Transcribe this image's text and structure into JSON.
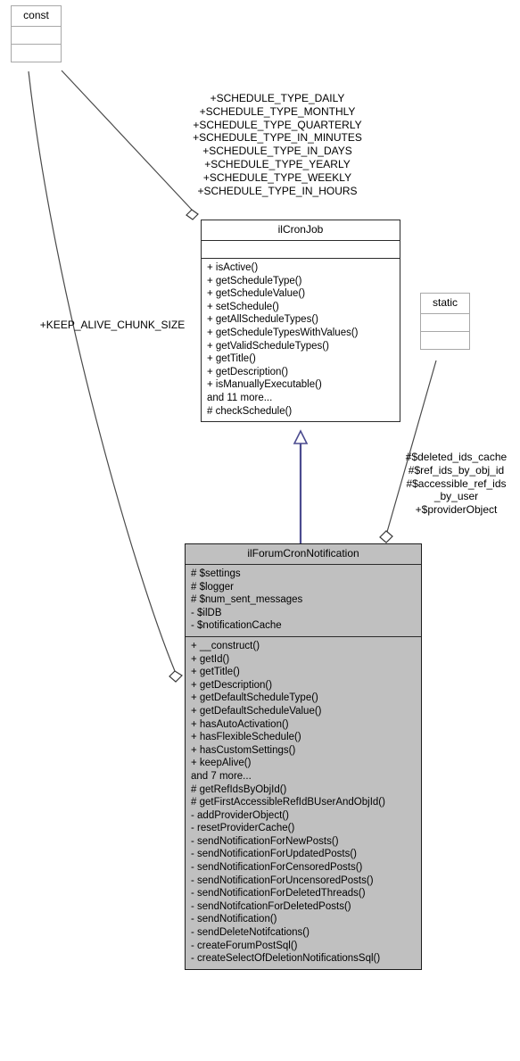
{
  "diagram": {
    "type": "uml-class-diagram",
    "main_class": "ilForumCronNotification"
  },
  "boxes": {
    "const": {
      "title": "const",
      "attributes": [],
      "methods": []
    },
    "cronjob": {
      "title": "ilCronJob",
      "attributes": [],
      "methods": [
        "+ isActive()",
        "+ getScheduleType()",
        "+ getScheduleValue()",
        "+ setSchedule()",
        "+ getAllScheduleTypes()",
        "+ getScheduleTypesWithValues()",
        "+ getValidScheduleTypes()",
        "+ getTitle()",
        "+ getDescription()",
        "+ isManuallyExecutable()",
        "and 11 more...",
        "# checkSchedule()"
      ]
    },
    "static": {
      "title": "static",
      "attributes": [],
      "methods": []
    },
    "main": {
      "title": "ilForumCronNotification",
      "attributes": [
        "# $settings",
        "# $logger",
        "# $num_sent_messages",
        "- $ilDB",
        "- $notificationCache"
      ],
      "methods": [
        "+ __construct()",
        "+ getId()",
        "+ getTitle()",
        "+ getDescription()",
        "+ getDefaultScheduleType()",
        "+ getDefaultScheduleValue()",
        "+ hasAutoActivation()",
        "+ hasFlexibleSchedule()",
        "+ hasCustomSettings()",
        "+ keepAlive()",
        "and 7 more...",
        "# getRefIdsByObjId()",
        "# getFirstAccessibleRefIdBUserAndObjId()",
        "- addProviderObject()",
        "- resetProviderCache()",
        "- sendNotificationForNewPosts()",
        "- sendNotificationForUpdatedPosts()",
        "- sendNotificationForCensoredPosts()",
        "- sendNotificationForUncensoredPosts()",
        "- sendNotificationForDeletedThreads()",
        "- sendNotifcationForDeletedPosts()",
        "- sendNotification()",
        "- sendDeleteNotifcations()",
        "- createForumPostSql()",
        "- createSelectOfDeletionNotificationsSql()"
      ]
    }
  },
  "edge_labels": {
    "schedule_types": "+SCHEDULE_TYPE_DAILY\n+SCHEDULE_TYPE_MONTHLY\n+SCHEDULE_TYPE_QUARTERLY\n+SCHEDULE_TYPE_IN_MINUTES\n+SCHEDULE_TYPE_IN_DAYS\n+SCHEDULE_TYPE_YEARLY\n+SCHEDULE_TYPE_WEEKLY\n+SCHEDULE_TYPE_IN_HOURS",
    "keep_alive": "+KEEP_ALIVE_CHUNK_SIZE",
    "provider": "#$deleted_ids_cache\n#$ref_ids_by_obj_id\n#$accessible_ref_ids\n_by_user\n+$providerObject"
  },
  "colors": {
    "main_class_fill": "#c0c0c0",
    "box_border": "#2b2b2b",
    "small_box_border": "#a8a8a8",
    "inheritance_arrow": "#4b4b8f",
    "association_line": "#4a4a4a"
  }
}
